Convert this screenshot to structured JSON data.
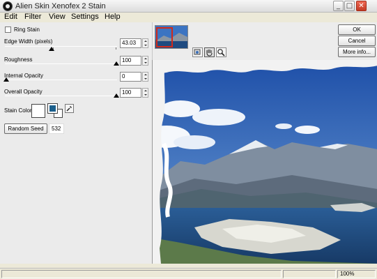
{
  "window": {
    "title": "Alien Skin Xenofex 2 Stain"
  },
  "menu": [
    {
      "label": "Edit"
    },
    {
      "label": "Filter"
    },
    {
      "label": "View"
    },
    {
      "label": "Settings"
    },
    {
      "label": "Help"
    }
  ],
  "controls": {
    "ring_stain": {
      "label": "Ring Stain",
      "checked": false
    },
    "edge_width": {
      "label": "Edge Width (pixels)",
      "value": "43.03",
      "level": 0.35
    },
    "roughness": {
      "label": "Roughness",
      "value": "100",
      "level": 1.0
    },
    "internal_opacity": {
      "label": "Internal Opacity",
      "value": "0",
      "level": 0.0
    },
    "overall_opacity": {
      "label": "Overall Opacity",
      "value": "100",
      "level": 1.0
    },
    "stain_color": {
      "label": "Stain Color",
      "color": "#ffffff",
      "small_front": "#1a5f8c",
      "small_back": "#ffffff"
    },
    "random_seed": {
      "button": "Random Seed",
      "value": "532"
    }
  },
  "buttons": {
    "ok": "OK",
    "cancel": "Cancel",
    "more_info": "More info..."
  },
  "status": {
    "zoom": "100%"
  },
  "colors": {
    "accent_red": "#d12a1a",
    "sky": "#2f6bbf",
    "water": "#1e4f86"
  }
}
